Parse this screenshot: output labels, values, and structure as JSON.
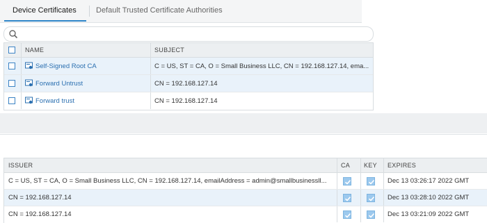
{
  "tabs": [
    {
      "label": "Device Certificates",
      "active": true
    },
    {
      "label": "Default Trusted Certificate Authorities",
      "active": false
    }
  ],
  "search": {
    "placeholder": ""
  },
  "top_table": {
    "columns": [
      "NAME",
      "SUBJECT"
    ],
    "rows": [
      {
        "name": "Self-Signed Root CA",
        "subject": "C = US, ST = CA, O = Small Business LLC, CN = 192.168.127.14, ema..."
      },
      {
        "name": "Forward Untrust",
        "subject": "CN = 192.168.127.14"
      },
      {
        "name": "Forward trust",
        "subject": "CN = 192.168.127.14"
      }
    ]
  },
  "bottom_table": {
    "columns": [
      "ISSUER",
      "CA",
      "KEY",
      "EXPIRES"
    ],
    "rows": [
      {
        "issuer": "C = US, ST = CA, O = Small Business LLC, CN = 192.168.127.14, emailAddress = admin@smallbusinessll...",
        "ca": true,
        "key": true,
        "expires": "Dec 13 03:26:17 2022 GMT"
      },
      {
        "issuer": "CN = 192.168.127.14",
        "ca": true,
        "key": true,
        "expires": "Dec 13 03:28:10 2022 GMT"
      },
      {
        "issuer": "CN = 192.168.127.14",
        "ca": true,
        "key": true,
        "expires": "Dec 13 03:21:09 2022 GMT"
      }
    ]
  },
  "colors": {
    "accent": "#2f86c8",
    "link": "#2a6fb0",
    "row_highlight": "#e9f2fa",
    "checkbox_checked": "#9cc9ee"
  },
  "icons": {
    "search": "search-icon",
    "certificate": "certificate-icon",
    "check": "checkmark-icon"
  }
}
